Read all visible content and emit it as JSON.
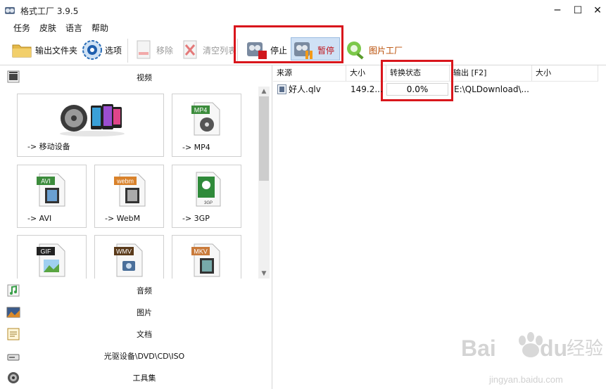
{
  "window": {
    "title": "格式工厂 3.9.5",
    "minimize_icon": "minimize-icon",
    "maximize_icon": "maximize-icon",
    "close_icon": "close-icon"
  },
  "menu": [
    "任务",
    "皮肤",
    "语言",
    "帮助"
  ],
  "toolbar": {
    "output_folder": "输出文件夹",
    "options": "选项",
    "remove": "移除",
    "clear_list": "清空列表",
    "stop": "停止",
    "pause": "暂停",
    "picture_factory": "图片工厂"
  },
  "categories": {
    "video": "视频",
    "audio": "音频",
    "image": "图片",
    "document": "文档",
    "optical": "光驱设备\\DVD\\CD\\ISO",
    "tools": "工具集"
  },
  "tiles": {
    "mobile": {
      "label": "-> 移动设备"
    },
    "mp4": {
      "label": "-> MP4",
      "badge": "MP4"
    },
    "avi": {
      "label": "-> AVI",
      "badge": "AVI"
    },
    "webm": {
      "label": "-> WebM",
      "badge": "webm"
    },
    "3gp": {
      "label": "-> 3GP",
      "badge": "3GP"
    },
    "gif": {
      "badge": "GIF"
    },
    "wmv": {
      "badge": "WMV"
    },
    "mkv": {
      "badge": "MKV"
    }
  },
  "columns": {
    "source": "来源",
    "size": "大小",
    "status": "转换状态",
    "output": "输出 [F2]",
    "out_size": "大小"
  },
  "task": {
    "name": "好人.qlv",
    "size": "149.2...",
    "status": "0.0%",
    "output": "E:\\QLDownload\\..."
  },
  "watermark": {
    "brand": "Bai",
    "brand2": "du",
    "cn": "经验",
    "url": "jingyan.baidu.com"
  },
  "colors": {
    "highlight": "#d9161c",
    "accent": "#1e6fcf"
  }
}
